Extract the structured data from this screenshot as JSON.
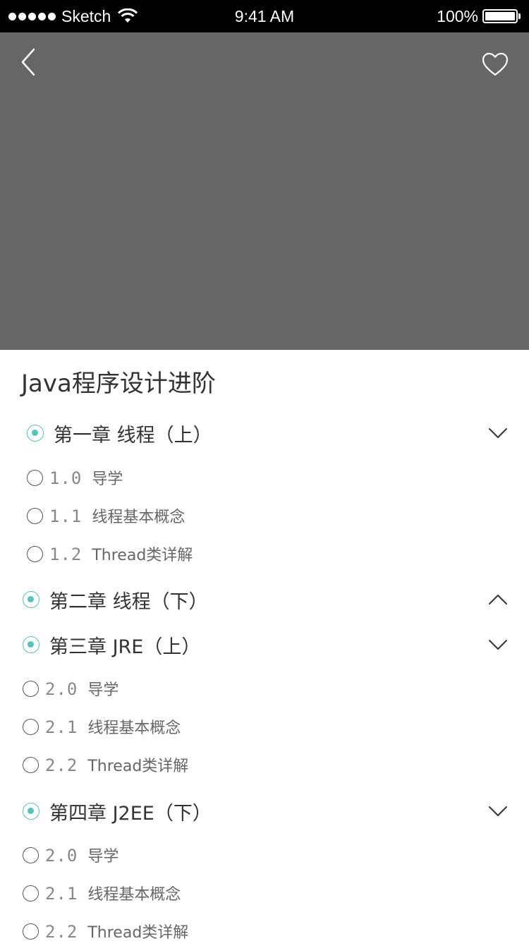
{
  "status_bar": {
    "carrier": "Sketch",
    "time": "9:41 AM",
    "battery": "100%",
    "battery_level": 1.0
  },
  "header": {
    "back_icon": "chevron-left-icon",
    "favorite_icon": "heart-outline-icon",
    "hero_color": "#666666"
  },
  "course": {
    "title": "Java程序设计进阶"
  },
  "colors": {
    "accent": "#4dc6c0",
    "chapter_text": "#333333",
    "lesson_text": "#666666"
  },
  "chapters": [
    {
      "label": "第一章 线程（上）",
      "expanded": true,
      "chevron": "chevron-down-icon",
      "lessons": [
        {
          "num": "1.0",
          "text": "导学"
        },
        {
          "num": "1.1",
          "text": "线程基本概念"
        },
        {
          "num": "1.2",
          "text": "Thread类详解"
        }
      ]
    },
    {
      "label": "第二章 线程（下）",
      "expanded": false,
      "chevron": "chevron-up-icon",
      "lessons": []
    },
    {
      "label": "第三章 JRE（上）",
      "expanded": true,
      "chevron": "chevron-down-icon",
      "lessons": [
        {
          "num": "2.0",
          "text": "导学"
        },
        {
          "num": "2.1",
          "text": "线程基本概念"
        },
        {
          "num": "2.2",
          "text": "Thread类详解"
        }
      ]
    },
    {
      "label": "第四章 J2EE（下）",
      "expanded": true,
      "chevron": "chevron-down-icon",
      "lessons": [
        {
          "num": "2.0",
          "text": "导学"
        },
        {
          "num": "2.1",
          "text": "线程基本概念"
        },
        {
          "num": "2.2",
          "text": "Thread类详解"
        }
      ]
    }
  ]
}
